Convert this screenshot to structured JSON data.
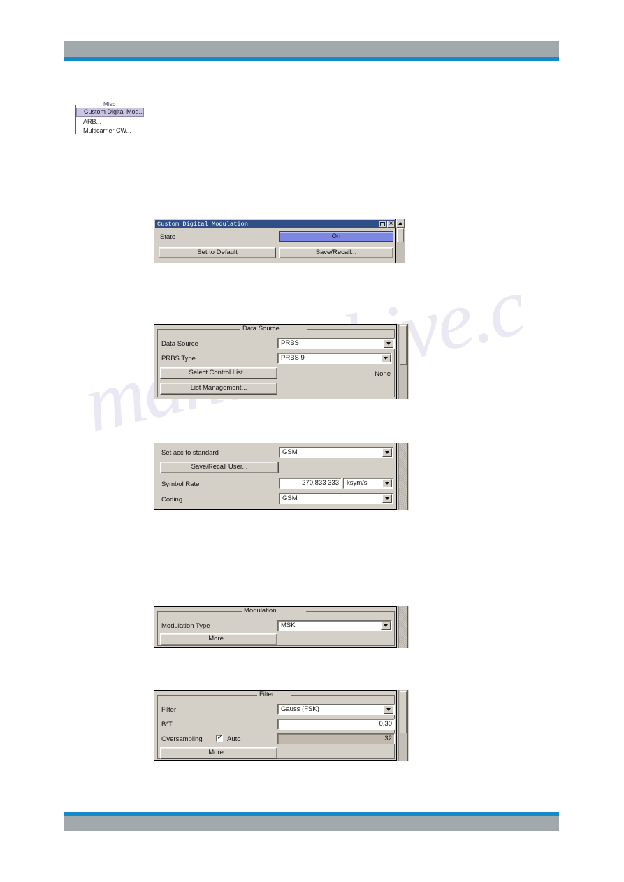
{
  "page": {
    "header_bar_color": "#a2a9ad",
    "accent_rule_color": "#1689c8",
    "watermark_text": "manualshive.c"
  },
  "misc_menu": {
    "legend": "Misc",
    "items": [
      {
        "label": "Custom Digital Mod...",
        "selected": true
      },
      {
        "label": "ARB...",
        "selected": false
      },
      {
        "label": "Multicarrier CW...",
        "selected": false
      }
    ],
    "highlight_color": "#c9c6e2"
  },
  "dialog_state": {
    "title": "Custom Digital Modulation",
    "titlebar_color": "#2f4f86",
    "minimize_icon": "minimize-icon",
    "close_icon": "close-icon",
    "rows": {
      "state_label": "State",
      "state_value": "On",
      "state_value_color": "#7b87e0"
    },
    "buttons": {
      "set_to_default": "Set to Default",
      "save_recall": "Save/Recall..."
    },
    "scroll_up_icon": "scroll-up-arrow-icon"
  },
  "data_source_panel": {
    "group_title": "Data Source",
    "rows": [
      {
        "label": "Data Source",
        "value": "PRBS"
      },
      {
        "label": "PRBS Type",
        "value": "PRBS 9"
      }
    ],
    "buttons": {
      "select_control_list": "Select Control List...",
      "list_management": "List Management..."
    },
    "control_list_value": "None"
  },
  "standard_panel": {
    "rows": {
      "set_acc_label": "Set acc to standard",
      "set_acc_value": "GSM",
      "symbol_rate_label": "Symbol Rate",
      "symbol_rate_value": "270.833 333",
      "symbol_rate_unit": "ksym/s",
      "coding_label": "Coding",
      "coding_value": "GSM"
    },
    "buttons": {
      "save_recall_user": "Save/Recall User..."
    }
  },
  "modulation_panel": {
    "group_title": "Modulation",
    "rows": {
      "modulation_type_label": "Modulation Type",
      "modulation_type_value": "MSK"
    },
    "buttons": {
      "more": "More..."
    }
  },
  "filter_panel": {
    "group_title": "Filter",
    "rows": {
      "filter_label": "Filter",
      "filter_value": "Gauss (FSK)",
      "bt_label": "B*T",
      "bt_value": "0.30",
      "oversampling_label": "Oversampling",
      "oversampling_auto_label": "Auto",
      "oversampling_auto_checked": true,
      "oversampling_value": "32"
    },
    "buttons": {
      "more": "More..."
    }
  }
}
